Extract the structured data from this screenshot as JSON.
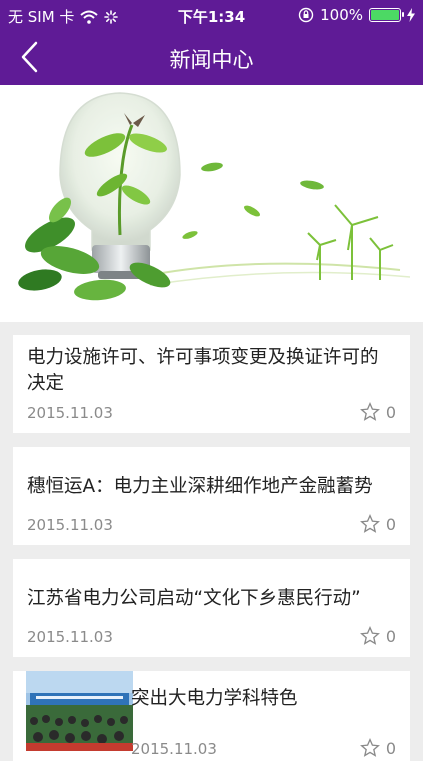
{
  "status_bar": {
    "carrier": "无 SIM 卡",
    "time": "下午1:34",
    "battery_pct": "100%",
    "battery_level": 1.0,
    "icons": [
      "wifi-icon",
      "activity-spinner-icon",
      "orientation-lock-icon",
      "battery-icon",
      "charging-icon"
    ]
  },
  "nav": {
    "title": "新闻中心",
    "back_icon": "chevron-left-icon"
  },
  "colors": {
    "header_bg": "#5f1b96",
    "page_bg": "#ededed",
    "battery": "#4cd964"
  },
  "news": [
    {
      "title": "电力设施许可、许可事项变更及换证许可的决定",
      "date": "2015.11.03",
      "likes": "0"
    },
    {
      "title": "穗恒运A：电力主业深耕细作地产金融蓄势",
      "date": "2015.11.03",
      "likes": "0"
    },
    {
      "title": "江苏省电力公司启动“文化下乡惠民行动”",
      "date": "2015.11.03",
      "likes": "0"
    },
    {
      "title": "突出大电力学科特色",
      "date": "2015.11.03",
      "likes": "0"
    }
  ]
}
